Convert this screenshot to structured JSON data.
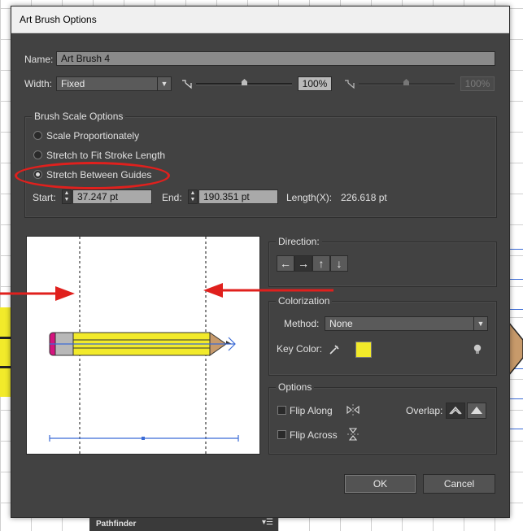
{
  "dialog": {
    "title": "Art Brush Options",
    "name_label": "Name:",
    "name_value": "Art Brush 4",
    "width_label": "Width:",
    "width_value": "Fixed",
    "width_percent": "100%",
    "width_percent_max": "100%",
    "brush_scale": {
      "title": "Brush Scale Options",
      "options": [
        {
          "label": "Scale Proportionately",
          "selected": false
        },
        {
          "label": "Stretch to Fit Stroke Length",
          "selected": false
        },
        {
          "label": "Stretch Between Guides",
          "selected": true
        }
      ],
      "start_label": "Start:",
      "start_value": "37.247 pt",
      "end_label": "End:",
      "end_value": "190.351 pt",
      "length_label": "Length(X):",
      "length_value": "226.618 pt"
    },
    "direction": {
      "title": "Direction:",
      "buttons": [
        "←",
        "→",
        "↑",
        "↓"
      ],
      "active_index": 1
    },
    "colorization": {
      "title": "Colorization",
      "method_label": "Method:",
      "method_value": "None",
      "key_color_label": "Key Color:",
      "key_color": "#f2ea2a"
    },
    "options": {
      "title": "Options",
      "flip_along_label": "Flip Along",
      "flip_across_label": "Flip Across",
      "overlap_label": "Overlap:"
    },
    "ok_label": "OK",
    "cancel_label": "Cancel"
  },
  "pathfinder": {
    "label": "Pathfinder",
    "menu": "▾☰"
  },
  "colors": {
    "dialog_bg": "#424242",
    "pencil_yellow": "#f2ea2a",
    "annotation_red": "#e0201d",
    "guide_blue": "#3b6bd6"
  }
}
